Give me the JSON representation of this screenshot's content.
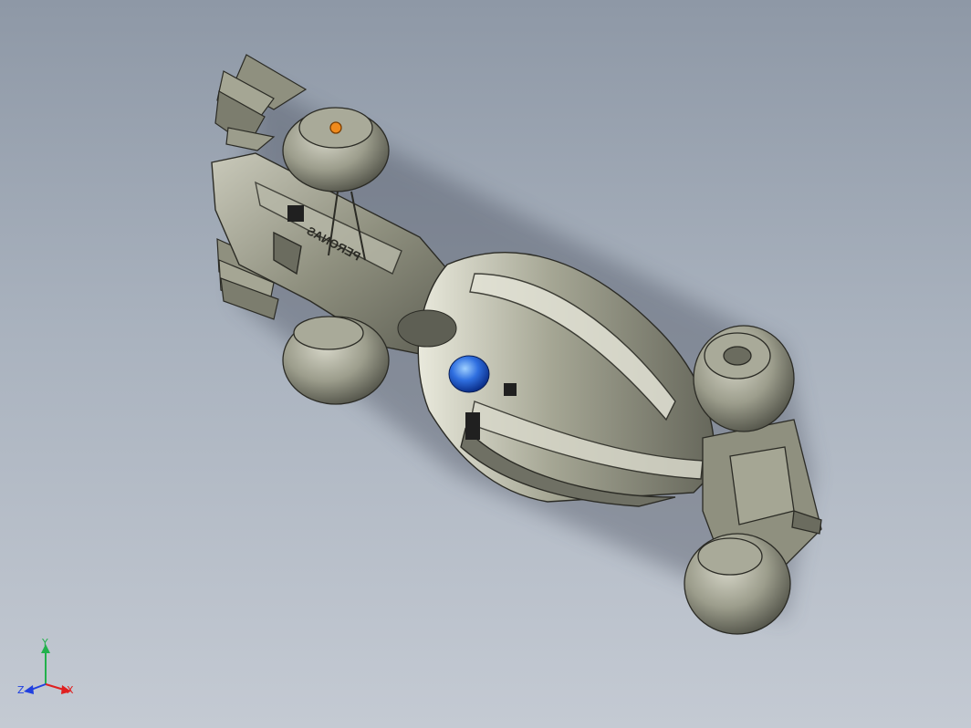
{
  "viewport": {
    "background_top": "#8e98a6",
    "background_bottom": "#c4cad3"
  },
  "model": {
    "decal_text": "PERONAS"
  },
  "triad": {
    "y_label": "Y",
    "x_label": "X",
    "z_label": "Z",
    "y_color": "#22b14c",
    "x_color": "#e02020",
    "z_color": "#2040e0"
  }
}
